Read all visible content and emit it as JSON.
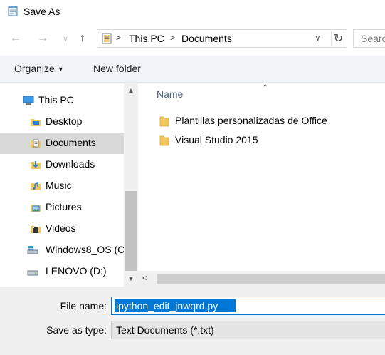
{
  "window": {
    "title": "Save As",
    "icon": "notepad-icon"
  },
  "nav": {
    "back_icon": "back-arrow-icon",
    "forward_icon": "forward-arrow-icon",
    "recent_icon": "chevron-down-icon",
    "up_icon": "up-arrow-icon",
    "breadcrumb": [
      "This PC",
      "Documents"
    ],
    "refresh_icon": "refresh-icon",
    "search_placeholder": "Searc"
  },
  "toolbar": {
    "organize_label": "Organize",
    "new_folder_label": "New folder"
  },
  "sidebar": {
    "items": [
      {
        "label": "This PC",
        "icon": "computer-icon",
        "level": 0,
        "selected": false
      },
      {
        "label": "Desktop",
        "icon": "desktop-folder-icon",
        "level": 1,
        "selected": false
      },
      {
        "label": "Documents",
        "icon": "documents-folder-icon",
        "level": 1,
        "selected": true
      },
      {
        "label": "Downloads",
        "icon": "downloads-folder-icon",
        "level": 1,
        "selected": false
      },
      {
        "label": "Music",
        "icon": "music-folder-icon",
        "level": 1,
        "selected": false
      },
      {
        "label": "Pictures",
        "icon": "pictures-folder-icon",
        "level": 1,
        "selected": false
      },
      {
        "label": "Videos",
        "icon": "videos-folder-icon",
        "level": 1,
        "selected": false
      },
      {
        "label": "Windows8_OS (C",
        "icon": "os-drive-icon",
        "level": 1,
        "selected": false
      },
      {
        "label": "LENOVO (D:)",
        "icon": "drive-icon",
        "level": 1,
        "selected": false
      }
    ]
  },
  "files": {
    "column_name": "Name",
    "items": [
      {
        "label": "Plantillas personalizadas de Office",
        "icon": "folder-icon"
      },
      {
        "label": "Visual Studio 2015",
        "icon": "folder-icon"
      }
    ]
  },
  "form": {
    "filename_label": "File name:",
    "filename_value": "ipython_edit_jnwqrd.py",
    "type_label": "Save as type:",
    "type_value": "Text Documents (*.txt)"
  },
  "colors": {
    "selection": "#0078d7",
    "toolbar_bg": "#f0f4f9",
    "selected_row": "#d9d9d9",
    "header_text": "#4c607a"
  }
}
